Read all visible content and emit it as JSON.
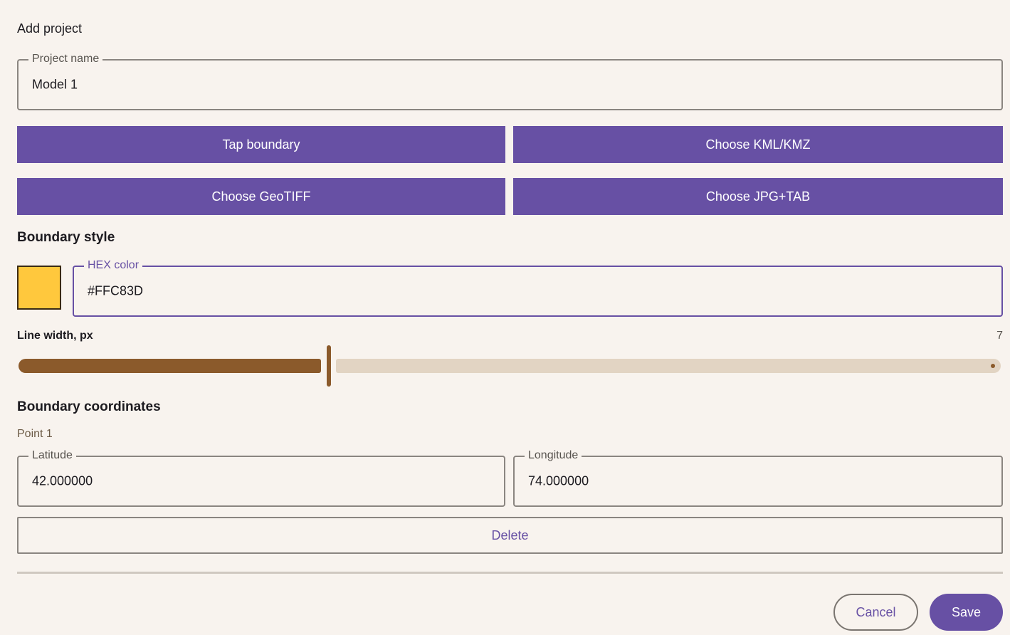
{
  "dialog": {
    "title": "Add project"
  },
  "project_name": {
    "label": "Project name",
    "value": "Model 1"
  },
  "buttons": {
    "tap_boundary": "Tap boundary",
    "choose_kml": "Choose KML/KMZ",
    "choose_geotiff": "Choose GeoTIFF",
    "choose_jpg_tab": "Choose JPG+TAB"
  },
  "boundary_style": {
    "title": "Boundary style",
    "hex_label": "HEX color",
    "hex_value": "#FFC83D",
    "swatch_color": "#FFC83D",
    "line_width_label": "Line width, px",
    "line_width_value": "7",
    "slider_fraction": 0.31
  },
  "coordinates": {
    "title": "Boundary coordinates",
    "points": [
      {
        "label": "Point 1",
        "latitude_label": "Latitude",
        "latitude": "42.000000",
        "longitude_label": "Longitude",
        "longitude": "74.000000",
        "delete_label": "Delete"
      }
    ]
  },
  "actions": {
    "cancel": "Cancel",
    "save": "Save"
  },
  "colors": {
    "accent": "#6750a4",
    "slider": "#8b5a2b",
    "slider_track": "#e2d4c3",
    "background": "#f8f3ee"
  }
}
